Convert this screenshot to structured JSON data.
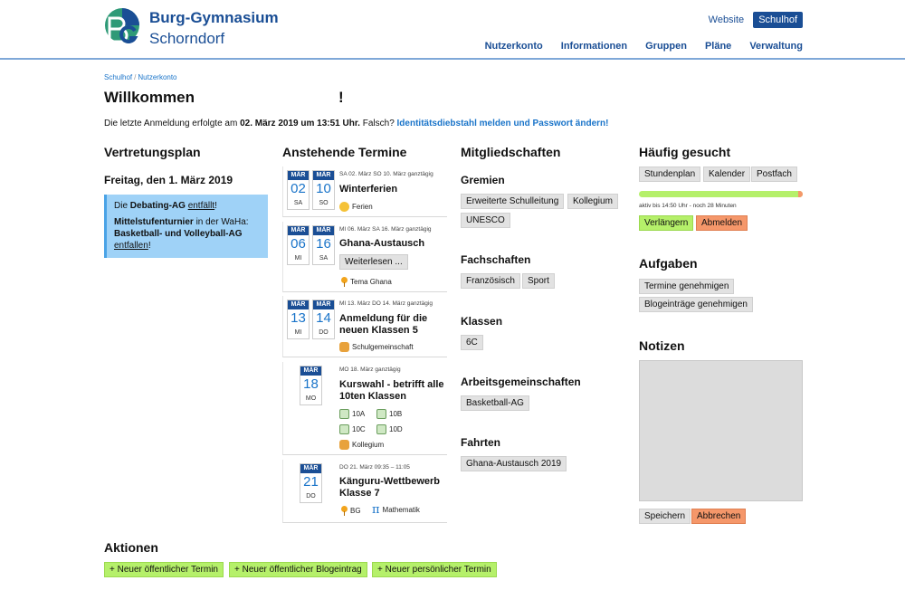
{
  "header": {
    "title": "Burg-Gymnasium",
    "subtitle": "Schorndorf",
    "top_links": {
      "website": "Website",
      "schulhof": "Schulhof"
    },
    "nav": [
      "Nutzerkonto",
      "Informationen",
      "Gruppen",
      "Pläne",
      "Verwaltung"
    ]
  },
  "breadcrumb": [
    "Schulhof",
    "Nutzerkonto"
  ],
  "welcome": {
    "title": "Willkommen",
    "mark": "!"
  },
  "last_login": {
    "prefix": "Die letzte Anmeldung erfolgte am",
    "datetime": "02. März 2019 um 13:51 Uhr.",
    "question": "Falsch?",
    "report_link": "Identitätsdiebstahl melden und Passwort ändern!"
  },
  "vertretungsplan": {
    "title": "Vertretungsplan",
    "date": "Freitag, den 1. März 2019",
    "line1_pre": "Die",
    "line1_bold": "Debating-AG",
    "line1_link": "entfällt",
    "line1_post": "!",
    "line2_bold": "Mittelstufenturnier",
    "line2_rest": "in der WaHa:",
    "line3_bold": "Basketball- und Volleyball-AG",
    "line4_link": "entfallen",
    "line4_post": "!"
  },
  "termine": {
    "title": "Anstehende Termine",
    "events": [
      {
        "m1": "MÄR",
        "d1": "02",
        "w1": "SA",
        "m2": "MÄR",
        "d2": "10",
        "w2": "SO",
        "meta": "SA 02. März SO 10. März ganztägig",
        "title": "Winterferien",
        "tags": [
          "Ferien"
        ]
      },
      {
        "m1": "MÄR",
        "d1": "06",
        "w1": "MI",
        "m2": "MÄR",
        "d2": "16",
        "w2": "SA",
        "meta": "MI 06. März SA 16. März ganztägig",
        "title": "Ghana-Austausch",
        "more": "Weiterlesen ...",
        "tags": [
          "Tema Ghana"
        ]
      },
      {
        "m1": "MÄR",
        "d1": "13",
        "w1": "MI",
        "m2": "MÄR",
        "d2": "14",
        "w2": "DO",
        "meta": "MI 13. März DO 14. März ganztägig",
        "title": "Anmeldung für die neuen Klassen 5",
        "tags": [
          "Schulgemeinschaft"
        ]
      },
      {
        "m1": "MÄR",
        "d1": "18",
        "w1": "MO",
        "meta": "MO 18. März ganztägig",
        "title": "Kurswahl - betrifft alle 10ten Klassen",
        "tags": [
          "10A",
          "10B",
          "10C",
          "10D",
          "Kollegium"
        ]
      },
      {
        "m1": "MÄR",
        "d1": "21",
        "w1": "DO",
        "meta": "DO 21. März 09:35 – 11:05",
        "title": "Känguru-Wettbewerb Klasse 7",
        "tags": [
          "BG",
          "Mathematik"
        ]
      }
    ]
  },
  "mitgliedschaften": {
    "title": "Mitgliedschaften",
    "gremien": {
      "title": "Gremien",
      "items": [
        "Erweiterte Schulleitung",
        "Kollegium",
        "UNESCO"
      ]
    },
    "fachschaften": {
      "title": "Fachschaften",
      "items": [
        "Französisch",
        "Sport"
      ]
    },
    "klassen": {
      "title": "Klassen",
      "items": [
        "6C"
      ]
    },
    "ags": {
      "title": "Arbeitsgemeinschaften",
      "items": [
        "Basketball-AG"
      ]
    },
    "fahrten": {
      "title": "Fahrten",
      "items": [
        "Ghana-Austausch 2019"
      ]
    }
  },
  "haeufig": {
    "title": "Häufig gesucht",
    "items": [
      "Stundenplan",
      "Kalender",
      "Postfach"
    ],
    "session_text": "aktiv bis 14:50 Uhr - noch 28 Minuten",
    "session_used_fraction": 0.03,
    "extend": "Verlängern",
    "logout": "Abmelden"
  },
  "aufgaben": {
    "title": "Aufgaben",
    "items": [
      "Termine genehmigen",
      "Blogeinträge genehmigen"
    ]
  },
  "notizen": {
    "title": "Notizen",
    "save": "Speichern",
    "cancel": "Abbrechen"
  },
  "aktionen": {
    "title": "Aktionen",
    "items": [
      "+ Neuer öffentlicher Termin",
      "+ Neuer öffentlicher Blogeintrag",
      "+ Neuer persönlicher Termin"
    ]
  },
  "colors": {
    "brand": "#1a4e95",
    "link": "#1a74c9",
    "green": "#b5f06a",
    "orange": "#f5976a",
    "info": "#9fd2f7"
  }
}
